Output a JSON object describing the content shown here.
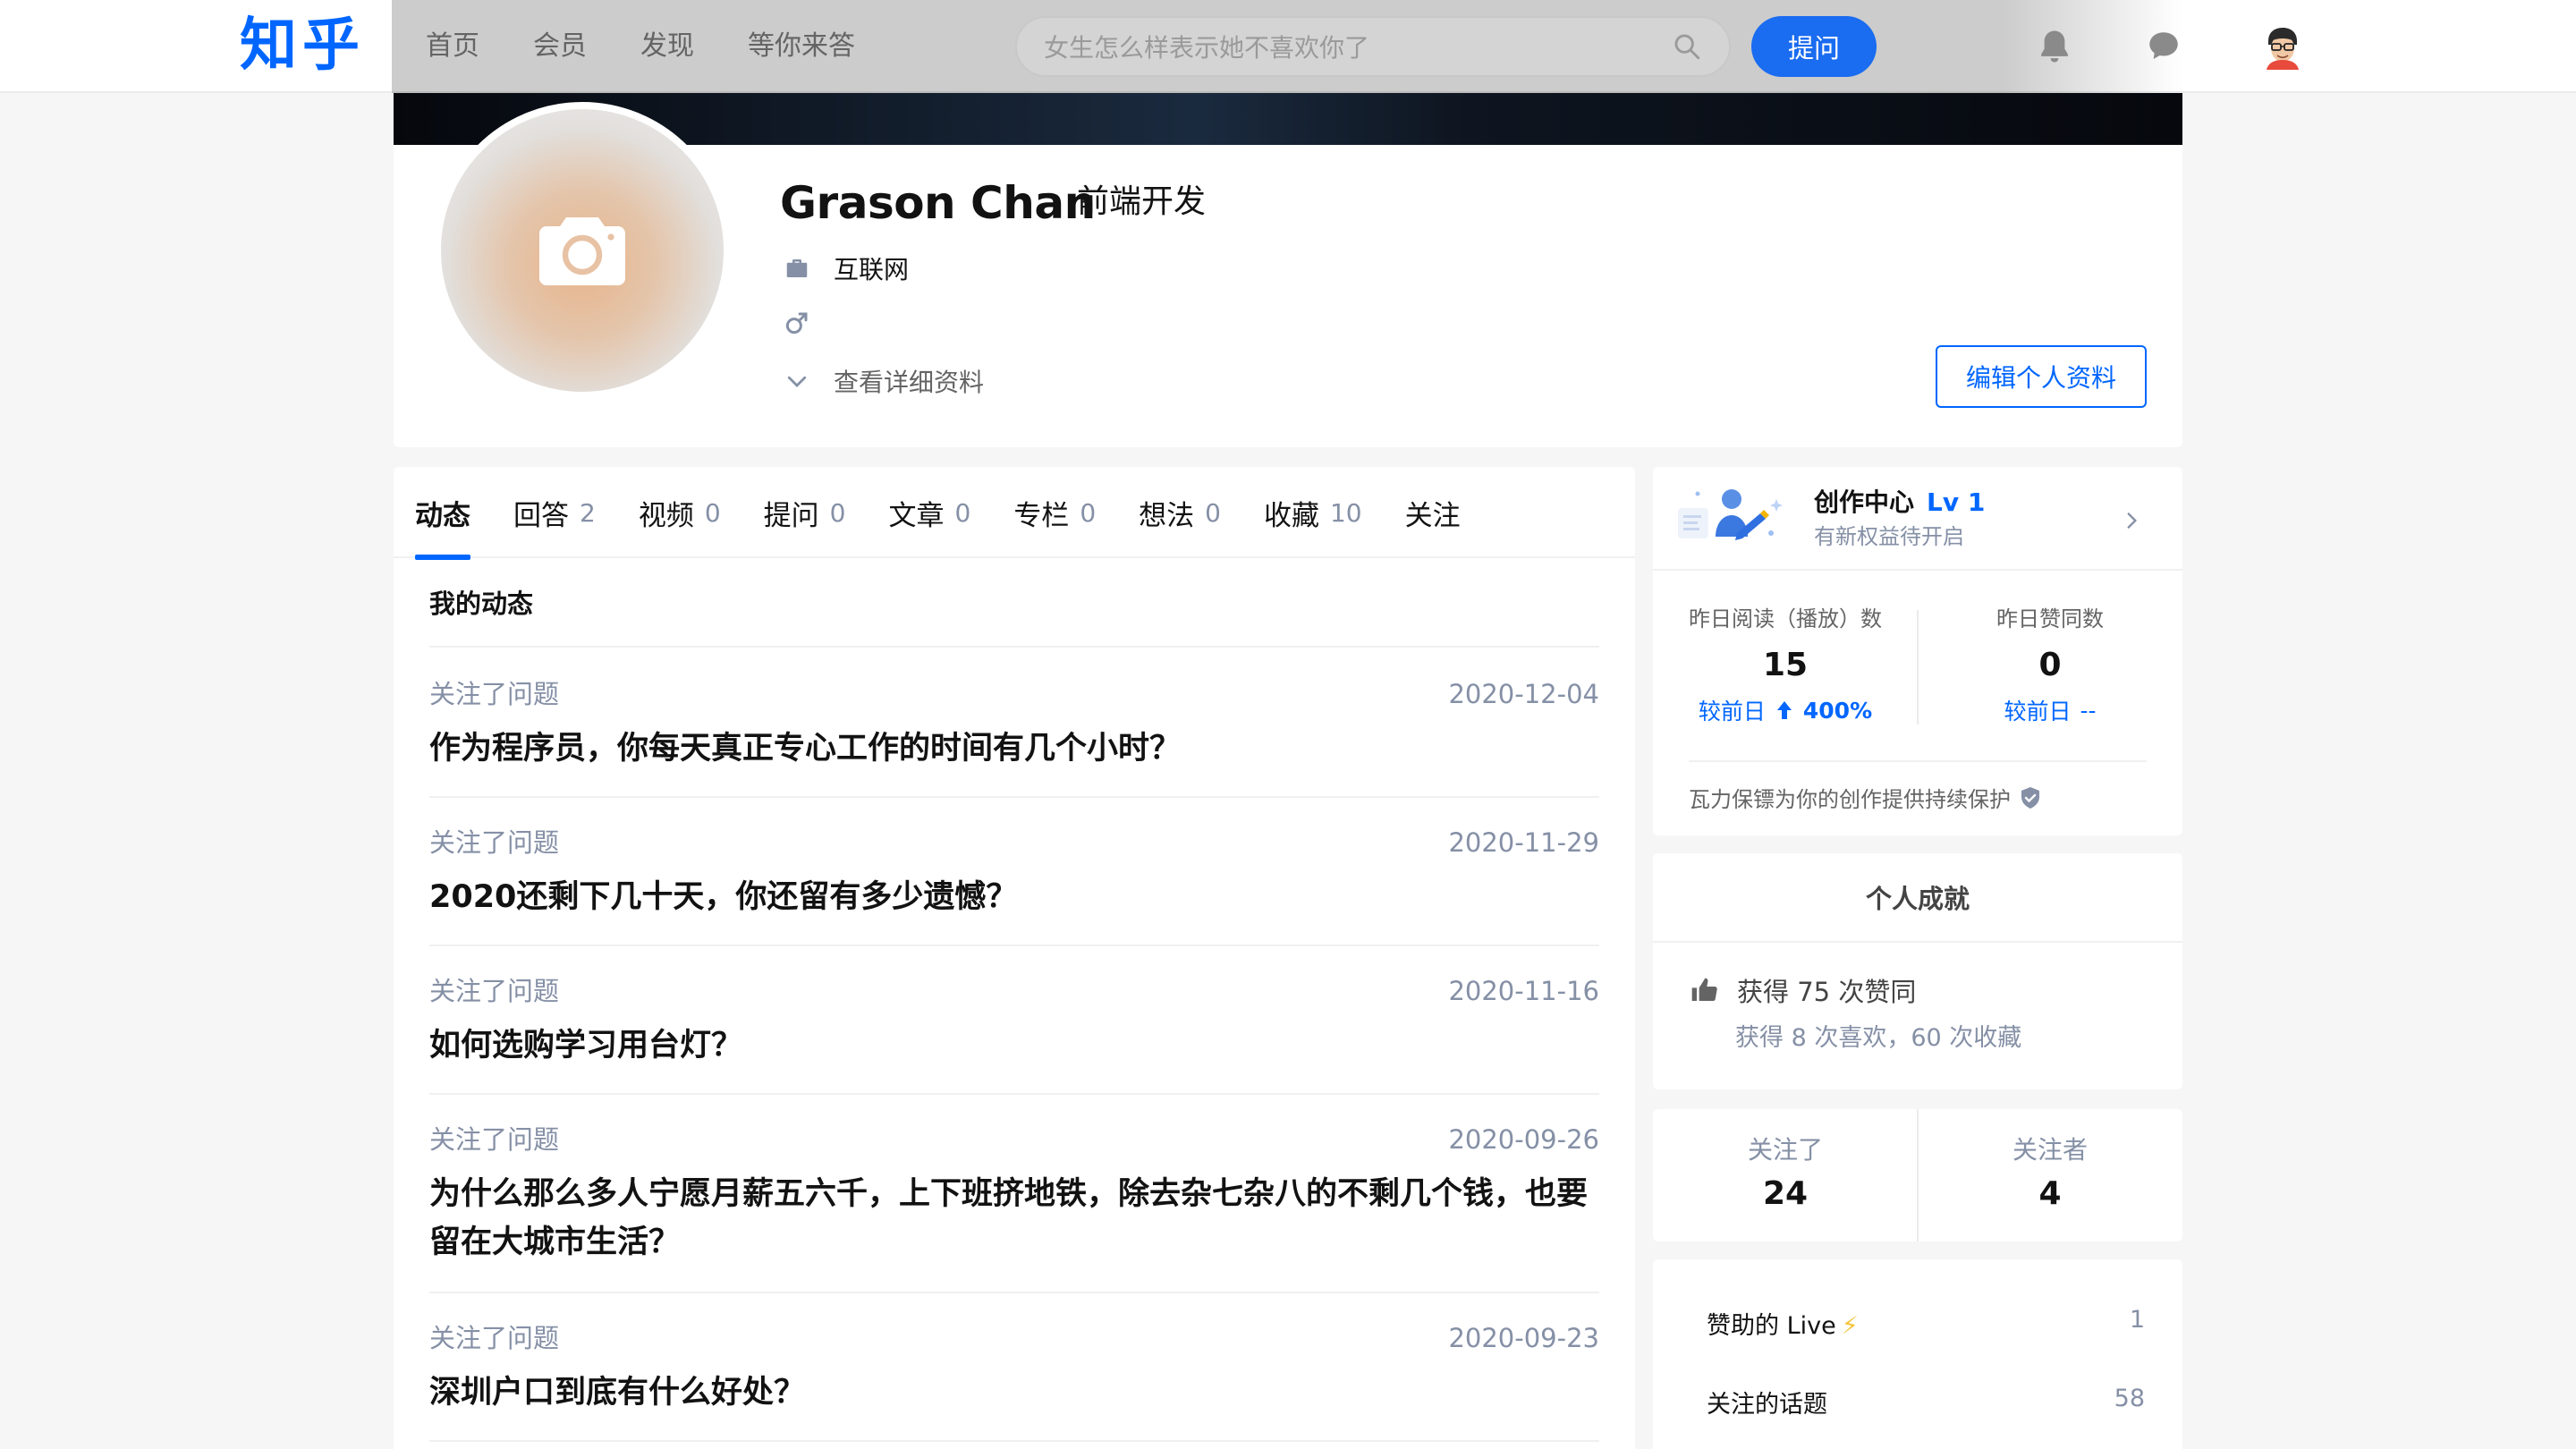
{
  "header": {
    "logo": "知乎",
    "nav": [
      "首页",
      "会员",
      "发现",
      "等你来答"
    ],
    "search_placeholder": "女生怎么样表示她不喜欢你了",
    "ask_label": "提问"
  },
  "profile": {
    "name": "Grason Chan",
    "headline": "前端开发",
    "industry": "互联网",
    "gender_symbol": "♂",
    "more_info": "查看详细资料",
    "edit_label": "编辑个人资料"
  },
  "tabs": [
    {
      "label": "动态",
      "count": ""
    },
    {
      "label": "回答",
      "count": "2"
    },
    {
      "label": "视频",
      "count": "0"
    },
    {
      "label": "提问",
      "count": "0"
    },
    {
      "label": "文章",
      "count": "0"
    },
    {
      "label": "专栏",
      "count": "0"
    },
    {
      "label": "想法",
      "count": "0"
    },
    {
      "label": "收藏",
      "count": "10"
    },
    {
      "label": "关注",
      "count": ""
    }
  ],
  "feed": {
    "title": "我的动态",
    "items": [
      {
        "action": "关注了问题",
        "date": "2020-12-04",
        "question": "作为程序员，你每天真正专心工作的时间有几个小时？"
      },
      {
        "action": "关注了问题",
        "date": "2020-11-29",
        "question": "2020还剩下几十天，你还留有多少遗憾？"
      },
      {
        "action": "关注了问题",
        "date": "2020-11-16",
        "question": "如何选购学习用台灯？"
      },
      {
        "action": "关注了问题",
        "date": "2020-09-26",
        "question": "为什么那么多人宁愿月薪五六千，上下班挤地铁，除去杂七杂八的不剩几个钱，也要留在大城市生活？"
      },
      {
        "action": "关注了问题",
        "date": "2020-09-23",
        "question": "深圳户口到底有什么好处？"
      }
    ]
  },
  "creator": {
    "title": "创作中心",
    "level": "Lv 1",
    "subtitle": "有新权益待开启",
    "read_label": "昨日阅读（播放）数",
    "read_value": "15",
    "read_delta_label": "较前日",
    "read_delta_value": "400%",
    "like_label": "昨日赞同数",
    "like_value": "0",
    "like_delta_label": "较前日",
    "like_delta_value": "--",
    "footer": "瓦力保镖为你的创作提供持续保护"
  },
  "achievements": {
    "title": "个人成就",
    "likes": "获得 75 次赞同",
    "detail": "获得 8 次喜欢，60 次收藏"
  },
  "follow": {
    "following_label": "关注了",
    "following_count": "24",
    "followers_label": "关注者",
    "followers_count": "4"
  },
  "lists": [
    {
      "label": "赞助的 Live",
      "count": "1"
    },
    {
      "label": "关注的话题",
      "count": "58"
    }
  ],
  "colors": {
    "brand": "#0066ff",
    "muted": "#8590a6",
    "background": "#f6f6f6"
  },
  "icons": [
    "search-icon",
    "bell-icon",
    "message-icon",
    "camera-icon",
    "briefcase-icon",
    "male-icon",
    "chevron-down-icon",
    "chevron-right-icon",
    "arrow-up-icon",
    "shield-check-icon",
    "thumbs-up-icon",
    "lightning-icon"
  ]
}
